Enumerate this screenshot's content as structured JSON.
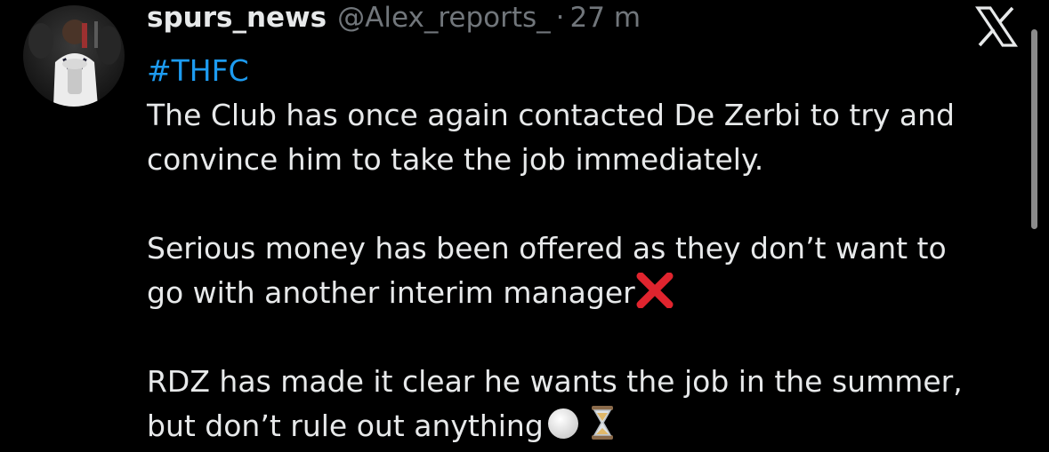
{
  "tweet": {
    "display_name": "spurs_news",
    "handle": "@Alex_reports_",
    "separator": "·",
    "timestamp": "27 m",
    "hashtag": "#THFC",
    "paragraph1": {
      "line1": "The Club has once again contacted De Zerbi to try and",
      "line2": "convince him to take the job immediately."
    },
    "paragraph2": {
      "line1": "Serious money has been offered as they don’t want to",
      "line2": "go with another interim manager"
    },
    "paragraph3": {
      "line1": "RDZ has made it clear he wants the job in the summer,",
      "line2": "but don’t rule out anything"
    },
    "icons": {
      "avatar": "avatar-photo",
      "platform_logo": "x-logo-icon",
      "cross_mark": "cross-mark-icon",
      "white_circle": "white-circle-icon",
      "hourglass": "hourglass-icon"
    },
    "colors": {
      "background": "#000000",
      "text": "#e7e9ea",
      "secondary": "#71767b",
      "link": "#1d9bf0",
      "cross": "#e0242e"
    }
  }
}
